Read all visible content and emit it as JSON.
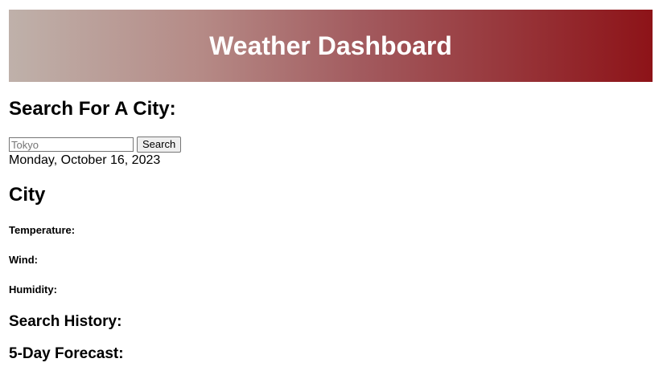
{
  "header": {
    "title": "Weather Dashboard",
    "gradient_colors": [
      "#bfb1aa",
      "#8d1318"
    ]
  },
  "search": {
    "heading": "Search For A City:",
    "placeholder": "Tokyo",
    "value": "",
    "button_label": "Search"
  },
  "current": {
    "date": "Monday, October 16, 2023",
    "city": "City",
    "temperature_label": "Temperature:",
    "wind_label": "Wind:",
    "humidity_label": "Humidity:"
  },
  "history": {
    "heading": "Search History:"
  },
  "forecast": {
    "heading": "5-Day Forecast:"
  }
}
